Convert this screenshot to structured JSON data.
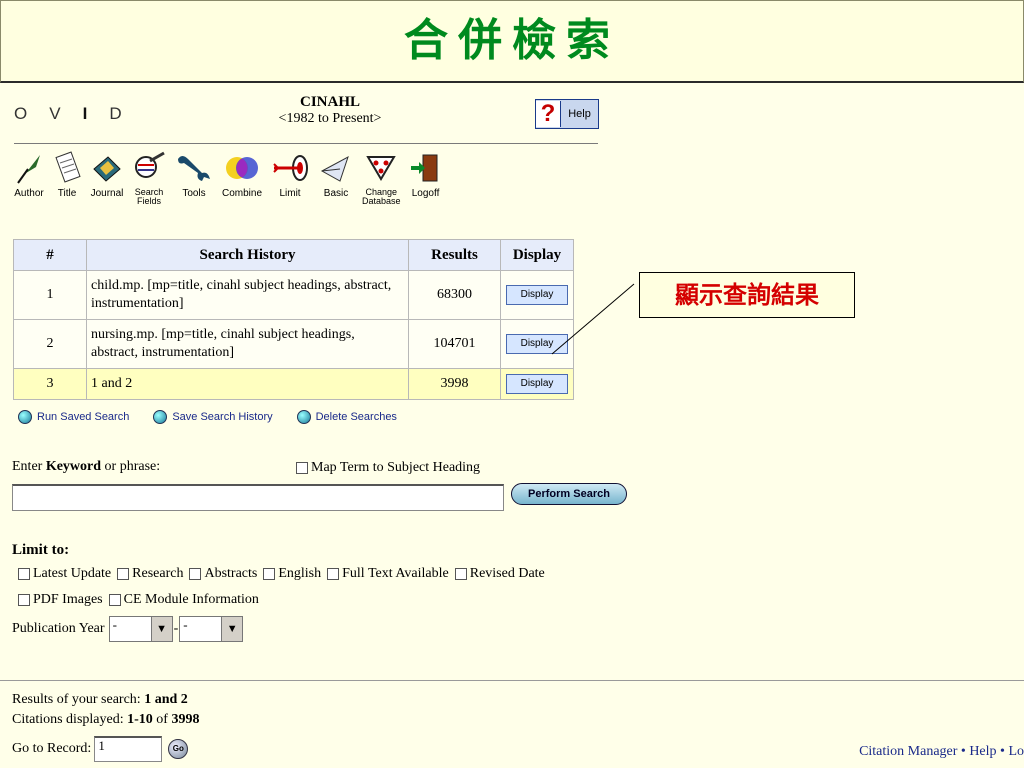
{
  "slide_title": "合併檢索",
  "annotation": "顯示查詢結果",
  "ovid": {
    "letters": [
      "O",
      "V",
      "I",
      "D"
    ]
  },
  "database": {
    "name": "CINAHL",
    "range": "<1982 to Present>"
  },
  "help": {
    "glyph": "?",
    "label": "Help"
  },
  "toolbar": [
    {
      "label": "Author",
      "icon": "quill-icon"
    },
    {
      "label": "Title",
      "icon": "document-icon"
    },
    {
      "label": "Journal",
      "icon": "journal-icon"
    },
    {
      "label": "Search Fields",
      "icon": "search-fields-icon"
    },
    {
      "label": "Tools",
      "icon": "wrench-icon"
    },
    {
      "label": "Combine",
      "icon": "combine-icon"
    },
    {
      "label": "Limit",
      "icon": "target-icon"
    },
    {
      "label": "Basic",
      "icon": "basic-icon"
    },
    {
      "label": "Change Database",
      "icon": "change-database-icon"
    },
    {
      "label": "Logoff",
      "icon": "door-icon"
    }
  ],
  "history": {
    "headers": [
      "#",
      "Search History",
      "Results",
      "Display"
    ],
    "rows": [
      {
        "num": "1",
        "query": "child.mp. [mp=title, cinahl subject headings, abstract, instrumentation]",
        "results": "68300",
        "button": "Display"
      },
      {
        "num": "2",
        "query": "nursing.mp. [mp=title, cinahl subject headings, abstract, instrumentation]",
        "results": "104701",
        "button": "Display"
      },
      {
        "num": "3",
        "query": "1 and 2",
        "results": "3998",
        "button": "Display"
      }
    ]
  },
  "actions": [
    "Run Saved Search",
    "Save Search History",
    "Delete Searches"
  ],
  "keyword": {
    "prefix": "Enter ",
    "bold": "Keyword",
    "suffix": " or phrase:",
    "value": "",
    "map_term": "Map Term to Subject Heading",
    "button": "Perform Search"
  },
  "limits": {
    "title": "Limit to:",
    "row1": [
      "Latest Update",
      "Research",
      "Abstracts",
      "English",
      "Full Text Available",
      "Revised Date"
    ],
    "row2": [
      "PDF Images",
      "CE Module Information"
    ],
    "pub_year_label": "Publication Year",
    "pub_from": "-",
    "pub_sep": "-",
    "pub_to": "-"
  },
  "results": {
    "label1": "Results of your search: ",
    "value1": "1 and 2",
    "label2": "Citations displayed: ",
    "value2a": "1-10",
    "of": " of ",
    "value2b": "3998"
  },
  "goto": {
    "label": "Go to Record:",
    "value": "1",
    "button": "Go"
  },
  "footer": "Citation Manager • Help • Lo"
}
